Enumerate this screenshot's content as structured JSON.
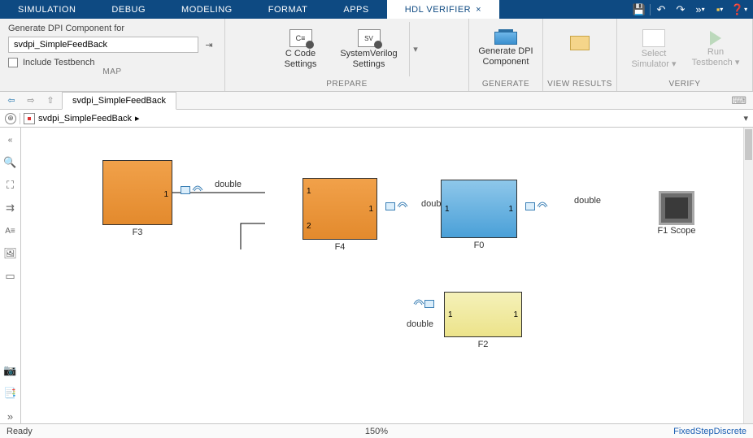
{
  "tabs": {
    "items": [
      "SIMULATION",
      "DEBUG",
      "MODELING",
      "FORMAT",
      "APPS",
      "HDL VERIFIER"
    ],
    "active_index": 5,
    "close_glyph": "×"
  },
  "qat": {
    "save": "💾",
    "undo": "↶",
    "redo": "↷",
    "fwd": "»",
    "fav": "▪",
    "help": "❓",
    "caret": "▾"
  },
  "ribbon": {
    "map": {
      "title": "MAP",
      "label": "Generate DPI Component for",
      "value": "svdpi_SimpleFeedBack",
      "login_glyph": "⇥",
      "include_tb": "Include Testbench"
    },
    "prepare": {
      "title": "PREPARE",
      "ccode": "C Code\nSettings",
      "sv": "SystemVerilog\nSettings",
      "caret": "▾"
    },
    "generate": {
      "title": "GENERATE",
      "btn": "Generate DPI\nComponent"
    },
    "view": {
      "title": "VIEW RESULTS",
      "open_folder_glyph": "📂"
    },
    "verify": {
      "title": "VERIFY",
      "select_sim": "Select\nSimulator",
      "run_tb": "Run\nTestbench",
      "caret": "▾"
    }
  },
  "nav": {
    "back": "⇦",
    "fwd": "⇨",
    "up": "⇧",
    "doc_tab": "svdpi_SimpleFeedBack",
    "keyboard": "⌨"
  },
  "explorer": {
    "target": "⊕",
    "crumb": "svdpi_SimpleFeedBack",
    "crumb_arrow": "▸",
    "expand": "▾"
  },
  "canvas": {
    "blocks": {
      "F3": {
        "label": "F3",
        "out_port": "1"
      },
      "F4": {
        "label": "F4",
        "in1": "1",
        "in2": "2",
        "out": "1"
      },
      "F0": {
        "label": "F0",
        "in": "1",
        "out": "1"
      },
      "F2": {
        "label": "F2",
        "in": "1",
        "out": "1"
      },
      "Scope": {
        "label": "F1 Scope"
      }
    },
    "signals": {
      "d1": "double",
      "d2": "doub",
      "d3": "double",
      "d4": "double"
    }
  },
  "status": {
    "left": "Ready",
    "center": "150%",
    "right": "FixedStepDiscrete"
  },
  "side_tools": {
    "hide": "«",
    "zoom": "🔍",
    "fit": "⛶",
    "seq": "⇉",
    "atxt": "A≡",
    "img": "🖼",
    "legend": "▭",
    "cam": "📷",
    "book": "📑",
    "more": "»"
  }
}
